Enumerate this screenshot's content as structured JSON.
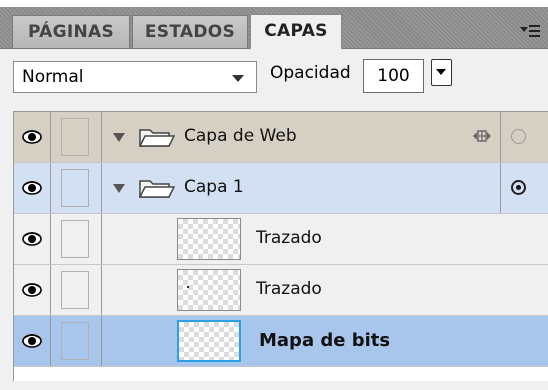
{
  "panel": {
    "tabs": [
      {
        "label": "PÁGINAS",
        "active": false
      },
      {
        "label": "ESTADOS",
        "active": false
      },
      {
        "label": "CAPAS",
        "active": true
      }
    ],
    "menu_icon": "panel-options-icon"
  },
  "controls": {
    "blend_mode": "Normal",
    "opacity_label": "Opacidad",
    "opacity_value": "100"
  },
  "layers": [
    {
      "name": "Capa de Web",
      "type": "folder",
      "expanded": true,
      "visible": true,
      "has_web_icon": true,
      "radio": "off"
    },
    {
      "name": "Capa 1",
      "type": "folder",
      "expanded": true,
      "visible": true,
      "radio": "on",
      "selected_row": true
    },
    {
      "name": "Trazado",
      "type": "object",
      "visible": true
    },
    {
      "name": "Trazado",
      "type": "object",
      "visible": true
    },
    {
      "name": "Mapa de bits",
      "type": "bitmap",
      "visible": true,
      "selected": true
    }
  ],
  "colors": {
    "tab_bar": "#8f8f8f",
    "folder_row": "#d6cfc4",
    "active_layer_row": "#d3e0f3",
    "selected_object": "#a8c6ec",
    "thumbnail_highlight": "#2aa0e6"
  }
}
